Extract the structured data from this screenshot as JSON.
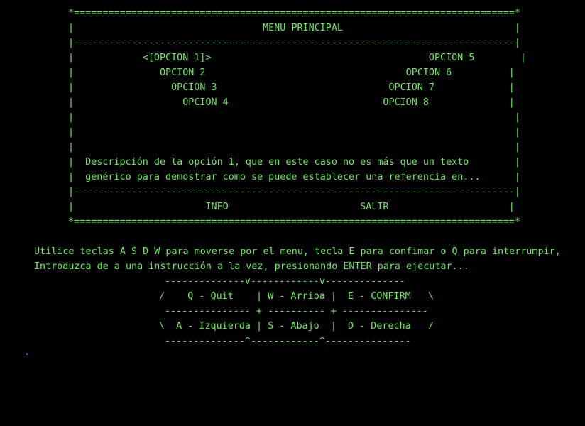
{
  "colors": {
    "background": "#000000",
    "text": "#6CEB5A",
    "cursor": "#4A6CE8"
  },
  "menu_box": {
    "top_border": "*=============================================================================*",
    "title_line": "|                                 MENU PRINCIPAL                              |",
    "separator_top": "|-----------------------------------------------------------------------------|",
    "option_lines": [
      "|            <[OPCION 1]>                                      OPCION 5        |",
      "|               OPCION 2                                   OPCION 6          |",
      "|                 OPCION 3                              OPCION 7             |",
      "|                   OPCION 4                           OPCION 8              |"
    ],
    "empty_lines": [
      "|                                                                             |",
      "|                                                                             |",
      "|                                                                             |"
    ],
    "description_lines": [
      "|  Descripción de la opción 1, que en este caso no es más que un texto        |",
      "|  genérico para demostrar como se puede establecer una referencia en...      |"
    ],
    "separator_bottom": "|-----------------------------------------------------------------------------|",
    "footer_line": "|                       INFO                       SALIR                     |",
    "bottom_border": "*=============================================================================*"
  },
  "instructions": [
    "Utilice teclas A S D W para moverse por el menu, tecla E para confimar o Q para interrumpir,",
    "Introduzca de a una instrucción a la vez, presionando ENTER para ejecutar..."
  ],
  "key_diagram": {
    "top": " --------------v------------v--------------",
    "row1": "/    Q - Quit    | W - Arriba |  E - CONFIRM   \\",
    "middle": " --------------- + ---------- + ---------------",
    "row2": "\\  A - Izquierda | S - Abajo  |  D - Derecha   /",
    "bottom": " --------------^------------^---------------"
  },
  "prompt_cursor": "▸"
}
